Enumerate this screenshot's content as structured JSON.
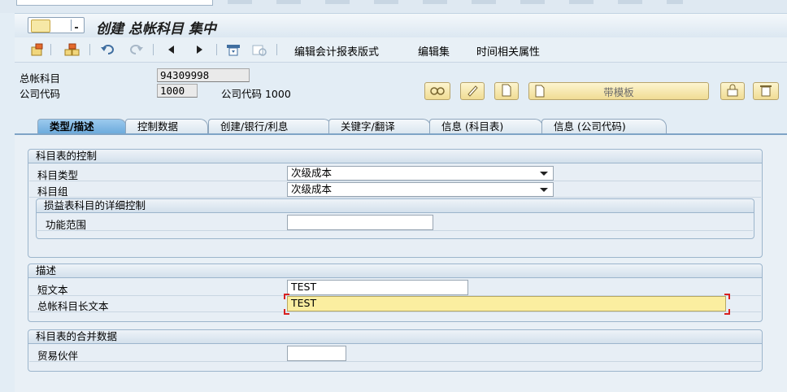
{
  "window": {
    "title": "创建 总帐科目 集中"
  },
  "toolbar": {
    "icons": [
      "new-item-icon",
      "hierarchy-icon",
      "undo-icon",
      "redo-icon",
      "previous-icon",
      "next-icon",
      "print-icon",
      "display-icon"
    ],
    "buttons": [
      "编辑会计报表版式",
      "编辑集",
      "时间相关属性"
    ]
  },
  "header": {
    "gl_account_label": "总帐科目",
    "gl_account_value": "94309998",
    "company_code_label": "公司代码",
    "company_code_value": "1000",
    "company_code_text": "公司代码 1000",
    "template_button": "带模板"
  },
  "tabs": [
    "类型/描述",
    "控制数据",
    "创建/银行/利息",
    "关键字/翻译",
    "信息 (科目表)",
    "信息 (公司代码)"
  ],
  "active_tab": "类型/描述",
  "sections": {
    "control": {
      "title": "科目表的控制",
      "account_type_label": "科目类型",
      "account_type_value": "次级成本",
      "account_group_label": "科目组",
      "account_group_value": "次级成本",
      "pl_detail_title": "损益表科目的详细控制",
      "functional_area_label": "功能范围",
      "functional_area_value": ""
    },
    "description": {
      "title": "描述",
      "short_text_label": "短文本",
      "short_text_value": "TEST",
      "long_text_label": "总帐科目长文本",
      "long_text_value": "TEST"
    },
    "consolidation": {
      "title": "科目表的合并数据",
      "trading_partner_label": "贸易伙伴",
      "trading_partner_value": ""
    }
  },
  "colors": {
    "active_tab": "#7fb4e2",
    "highlight_field": "#fbeea0",
    "background": "#e3edf5"
  }
}
